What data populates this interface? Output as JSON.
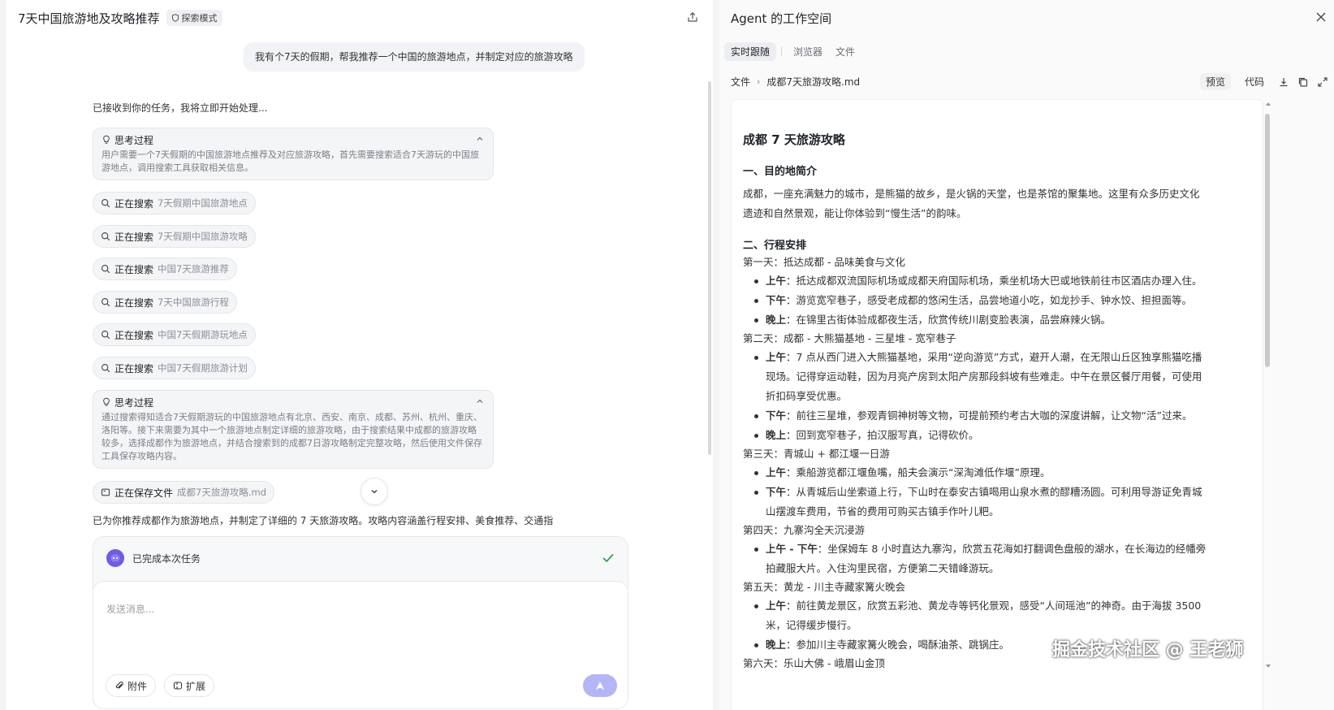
{
  "chat": {
    "title": "7天中国旅游地及攻略推荐",
    "mode_badge": "探索模式",
    "user_message": "我有个7天的假期，帮我推荐一个中国的旅游地点，并制定对应的旅游攻略",
    "ack": "已接收到你的任务，我将立即开始处理...",
    "thinking_1": {
      "label": "思考过程",
      "body": "用户需要一个7天假期的中国旅游地点推荐及对应旅游攻略，首先需要搜索适合7天游玩的中国旅游地点，调用搜索工具获取相关信息。"
    },
    "searches": [
      {
        "action": "正在搜索",
        "query": "7天假期中国旅游地点"
      },
      {
        "action": "正在搜索",
        "query": "7天假期中国旅游攻略"
      },
      {
        "action": "正在搜索",
        "query": "中国7天旅游推荐"
      },
      {
        "action": "正在搜索",
        "query": "7天中国旅游行程"
      },
      {
        "action": "正在搜索",
        "query": "中国7天假期游玩地点"
      },
      {
        "action": "正在搜索",
        "query": "中国7天假期旅游计划"
      }
    ],
    "thinking_2": {
      "label": "思考过程",
      "body": "通过搜索得知适合7天假期游玩的中国旅游地点有北京、西安、南京、成都、苏州、杭州、重庆、洛阳等。接下来需要为其中一个旅游地点制定详细的旅游攻略，由于搜索结果中成都的旅游攻略较多，选择成都作为旅游地点，并结合搜索到的成都7日游攻略制定完整攻略，然后使用文件保存工具保存攻略内容。"
    },
    "save_chip": {
      "action": "正在保存文件",
      "query": "成都7天旅游攻略.md"
    },
    "summary": "已为你推荐成都作为旅游地点，并制定了详细的 7 天旅游攻略。攻略内容涵盖行程安排、美食推荐、交通指",
    "status": "已完成本次任务",
    "input_placeholder": "发送消息...",
    "attach_label": "附件",
    "extend_label": "扩展"
  },
  "workspace": {
    "title": "Agent 的工作空间",
    "tabs": [
      "实时跟随",
      "浏览器",
      "文件"
    ],
    "active_tab": 0,
    "crumb_root": "文件",
    "crumb_file": "成都7天旅游攻略.md",
    "preview_label": "预览",
    "code_label": "代码"
  },
  "doc": {
    "title": "成都 7 天旅游攻略",
    "intro_heading": "一、目的地简介",
    "intro_line1": "成都，一座充满魅力的城市，是熊猫的故乡，是火锅的天堂，也是茶馆的聚集地。这里有众多历史文化",
    "intro_line2": "遗迹和自然景观，能让你体验到“慢生活”的韵味。",
    "itinerary_heading": "二、行程安排",
    "days": [
      {
        "title": "第一天：抵达成都 - 品味美食与文化",
        "items": [
          {
            "k": "上午",
            "lines": [
              "：抵达成都双流国际机场或成都天府国际机场，乘坐机场大巴或地铁前往市区酒店办理入住。"
            ]
          },
          {
            "k": "下午",
            "lines": [
              "：游览宽窄巷子，感受老成都的悠闲生活，品尝地道小吃，如龙抄手、钟水饺、担担面等。"
            ]
          },
          {
            "k": "晚上",
            "lines": [
              "：在锦里古街体验成都夜生活，欣赏传统川剧变脸表演，品尝麻辣火锅。"
            ]
          }
        ]
      },
      {
        "title": "第二天：成都 - 大熊猫基地 - 三星堆 - 宽窄巷子",
        "items": [
          {
            "k": "上午",
            "lines": [
              "：7 点从西门进入大熊猫基地，采用“逆向游览”方式，避开人潮，在无限山丘区独享熊猫吃播",
              "现场。记得穿运动鞋，因为月亮产房到太阳产房那段斜坡有些难走。中午在景区餐厅用餐，可使用",
              "折扣码享受优惠。"
            ]
          },
          {
            "k": "下午",
            "lines": [
              "：前往三星堆，参观青铜神树等文物，可提前预约考古大咖的深度讲解，让文物“活”过来。"
            ]
          },
          {
            "k": "晚上",
            "lines": [
              "：回到宽窄巷子，拍汉服写真，记得砍价。"
            ]
          }
        ]
      },
      {
        "title": "第三天：青城山 + 都江堰一日游",
        "items": [
          {
            "k": "上午",
            "lines": [
              "：乘船游览都江堰鱼嘴，船夫会演示“深淘滩低作堰”原理。"
            ]
          },
          {
            "k": "下午",
            "lines": [
              "：从青城后山坐索道上行，下山时在泰安古镇喝用山泉水煮的醪糟汤圆。可利用导游证免青城",
              "山摆渡车费用，节省的费用可购买古镇手作叶儿粑。"
            ]
          }
        ]
      },
      {
        "title": "第四天：九寨沟全天沉浸游",
        "items": [
          {
            "k": "上午 - 下午",
            "lines": [
              "：坐保姆车 8 小时直达九寨沟，欣赏五花海如打翻调色盘般的湖水，在长海边的经幡旁",
              "拍藏服大片。入住沟里民宿，方便第二天错峰游玩。"
            ]
          }
        ]
      },
      {
        "title": "第五天：黄龙 - 川主寺藏家篝火晚会",
        "items": [
          {
            "k": "上午",
            "lines": [
              "：前往黄龙景区，欣赏五彩池、黄龙寺等钙化景观，感受“人间瑶池”的神奇。由于海拔 3500",
              "米，记得缓步慢行。"
            ]
          },
          {
            "k": "晚上",
            "lines": [
              "：参加川主寺藏家篝火晚会，喝酥油茶、跳锅庄。"
            ]
          }
        ]
      },
      {
        "title": "第六天：乐山大佛 - 峨眉山金顶",
        "items": []
      }
    ]
  },
  "watermark": "掘金技术社区 @ 王老狮"
}
